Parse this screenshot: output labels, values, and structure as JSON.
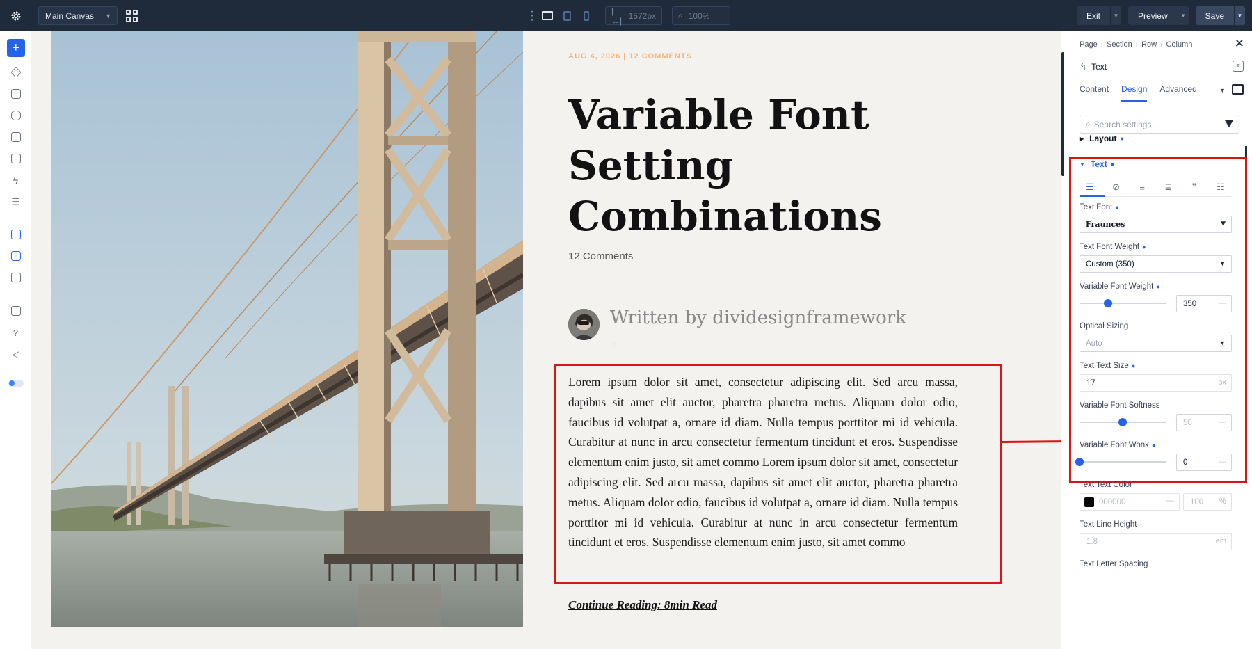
{
  "topbar": {
    "canvas_name": "Main Canvas",
    "width_value": "1572px",
    "zoom_value": "100%",
    "exit_label": "Exit",
    "preview_label": "Preview",
    "save_label": "Save"
  },
  "post": {
    "meta": "AUG 4, 2026 | 12 COMMENTS",
    "title": "Variable Font Setting Combinations",
    "comments": "12 Comments",
    "author_line": "Written by dividesignframework",
    "author_sub": "in",
    "body": "Lorem ipsum dolor sit amet, consectetur adipiscing elit. Sed arcu massa, dapibus sit amet elit auctor, pharetra pharetra metus. Aliquam dolor odio, faucibus id volutpat a, ornare id diam. Nulla tempus porttitor mi id vehicula. Curabitur at nunc in arcu consectetur fermentum tincidunt et eros. Suspendisse elementum enim justo, sit amet commo Lorem ipsum dolor sit amet, consectetur adipiscing elit. Sed arcu massa, dapibus sit amet elit auctor, pharetra pharetra metus. Aliquam dolor odio, faucibus id volutpat a, ornare id diam. Nulla tempus porttitor mi id vehicula. Curabitur at nunc in arcu consectetur fermentum tincidunt et eros. Suspendisse elementum enim justo, sit amet commo",
    "continue_link": "Continue Reading: 8min Read"
  },
  "panel": {
    "breadcrumbs": [
      "Page",
      "Section",
      "Row",
      "Column"
    ],
    "module_name": "Text",
    "tabs": [
      "Content",
      "Design",
      "Advanced"
    ],
    "active_tab": "Design",
    "search_placeholder": "Search settings...",
    "groups": {
      "layout": "Layout",
      "text": "Text"
    },
    "fields": {
      "text_font": {
        "label": "Text Font",
        "value": "Fraunces"
      },
      "text_font_weight": {
        "label": "Text Font Weight",
        "value": "Custom (350)"
      },
      "variable_font_weight": {
        "label": "Variable Font Weight",
        "value": "350",
        "slider_fraction": 0.33
      },
      "optical_sizing": {
        "label": "Optical Sizing",
        "value": "Auto"
      },
      "text_size": {
        "label": "Text Text Size",
        "value": "17",
        "unit": "px"
      },
      "variable_font_softness": {
        "label": "Variable Font Softness",
        "value": "50",
        "slider_fraction": 0.5
      },
      "variable_font_wonk": {
        "label": "Variable Font Wonk",
        "value": "0",
        "slider_fraction": 0
      },
      "text_color": {
        "label": "Text Text Color",
        "hex": "000000",
        "opacity": "100",
        "opacity_unit": "%",
        "swatch": "#000000"
      },
      "line_height": {
        "label": "Text Line Height",
        "value": "1.8",
        "unit": "em"
      },
      "letter_spacing": {
        "label": "Text Letter Spacing"
      }
    }
  },
  "colors": {
    "topbar_bg": "#1f2a3a",
    "accent": "#2563eb",
    "highlight": "#dc1414",
    "meta_orange": "#f0b47d"
  }
}
